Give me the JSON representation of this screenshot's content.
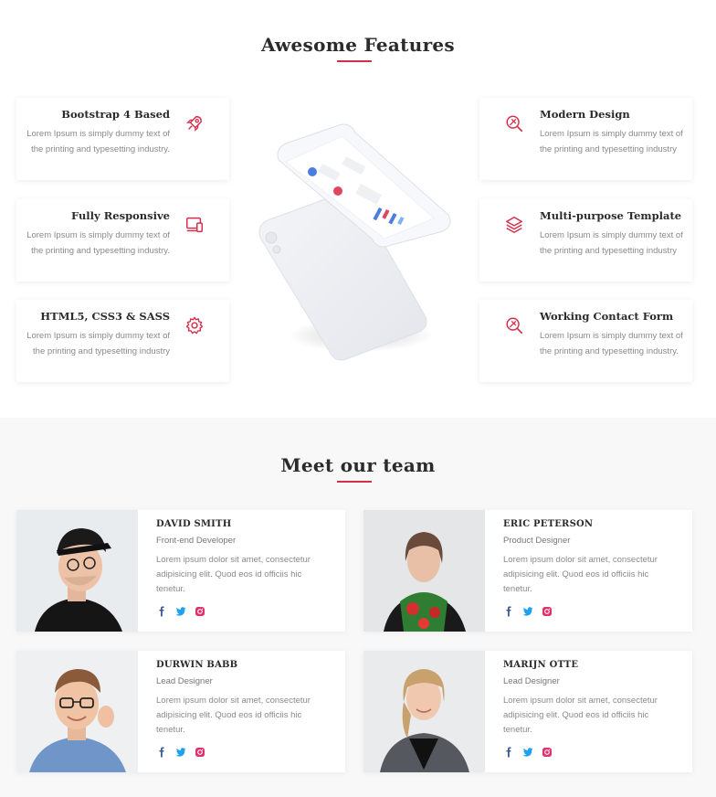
{
  "features": {
    "title": "Awesome Features",
    "accent": "#d32f4a",
    "left": [
      {
        "title": "Bootstrap 4 Based",
        "desc": "Lorem Ipsum is simply dummy text of the printing and typesetting industry.",
        "icon": "rocket-icon"
      },
      {
        "title": "Fully Responsive",
        "desc": "Lorem Ipsum is simply dummy text of the printing and typesetting industry.",
        "icon": "devices-icon"
      },
      {
        "title": "HTML5, CSS3 & SASS",
        "desc": "Lorem Ipsum is simply dummy text of the printing and typesetting industry",
        "icon": "gear-icon"
      }
    ],
    "right": [
      {
        "title": "Modern Design",
        "desc": "Lorem Ipsum is simply dummy text of the printing and typesetting industry",
        "icon": "design-icon"
      },
      {
        "title": "Multi-purpose Template",
        "desc": "Lorem Ipsum is simply dummy text of the printing and typesetting industry",
        "icon": "layers-icon"
      },
      {
        "title": "Working Contact Form",
        "desc": "Lorem Ipsum is simply dummy text of the printing and typesetting industry.",
        "icon": "design-icon"
      }
    ]
  },
  "team": {
    "title": "Meet our team",
    "members": [
      {
        "name": "DAVID SMITH",
        "role": "Front-end Developer",
        "desc": "Lorem ipsum dolor sit amet, consectetur adipisicing elit. Quod eos id officiis hic tenetur."
      },
      {
        "name": "ERIC PETERSON",
        "role": "Product Designer",
        "desc": "Lorem ipsum dolor sit amet, consectetur adipisicing elit. Quod eos id officiis hic tenetur."
      },
      {
        "name": "DURWIN BABB",
        "role": "Lead Designer",
        "desc": "Lorem ipsum dolor sit amet, consectetur adipisicing elit. Quod eos id officiis hic tenetur."
      },
      {
        "name": "MARIJN OTTE",
        "role": "Lead Designer",
        "desc": "Lorem ipsum dolor sit amet, consectetur adipisicing elit. Quod eos id officiis hic tenetur."
      }
    ],
    "social_icons": [
      "facebook-icon",
      "twitter-icon",
      "instagram-icon"
    ],
    "social_colors": {
      "facebook": "#3b5998",
      "twitter": "#1da1f2",
      "instagram": "#e1306c"
    }
  }
}
